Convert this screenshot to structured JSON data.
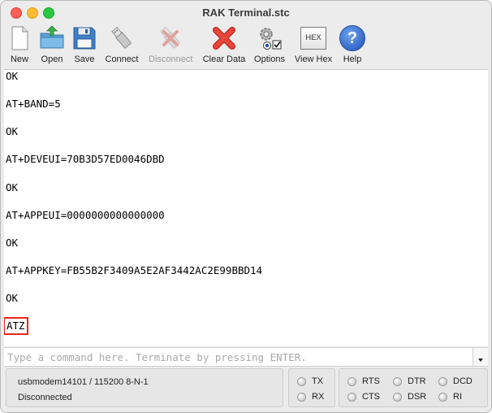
{
  "window": {
    "title": "RAK Terminal.stc"
  },
  "toolbar": {
    "new": "New",
    "open": "Open",
    "save": "Save",
    "connect": "Connect",
    "disconnect": "Disconnect",
    "clear_data": "Clear Data",
    "options": "Options",
    "view_hex": "View Hex",
    "hex_icon_text": "HEX",
    "help": "Help",
    "help_icon_text": "?"
  },
  "terminal": {
    "lines": [
      "OK",
      "AT+BAND=5",
      "OK",
      "AT+DEVEUI=70B3D57ED0046DBD",
      "OK",
      "AT+APPEUI=0000000000000000",
      "OK",
      "AT+APPKEY=FB55B2F3409A5E2AF3442AC2E99BBD14",
      "OK",
      "ATZ"
    ]
  },
  "command": {
    "placeholder": "Type a command here. Terminate by pressing ENTER.",
    "value": ""
  },
  "status": {
    "port": "usbmodem14101 / 115200 8-N-1",
    "connection": "Disconnected",
    "indicators": {
      "tx": "TX",
      "rx": "RX",
      "rts": "RTS",
      "cts": "CTS",
      "dtr": "DTR",
      "dsr": "DSR",
      "dcd": "DCD",
      "ri": "RI"
    }
  },
  "colors": {
    "highlight": "#e8281e",
    "placeholder": "#a8a8a8"
  }
}
